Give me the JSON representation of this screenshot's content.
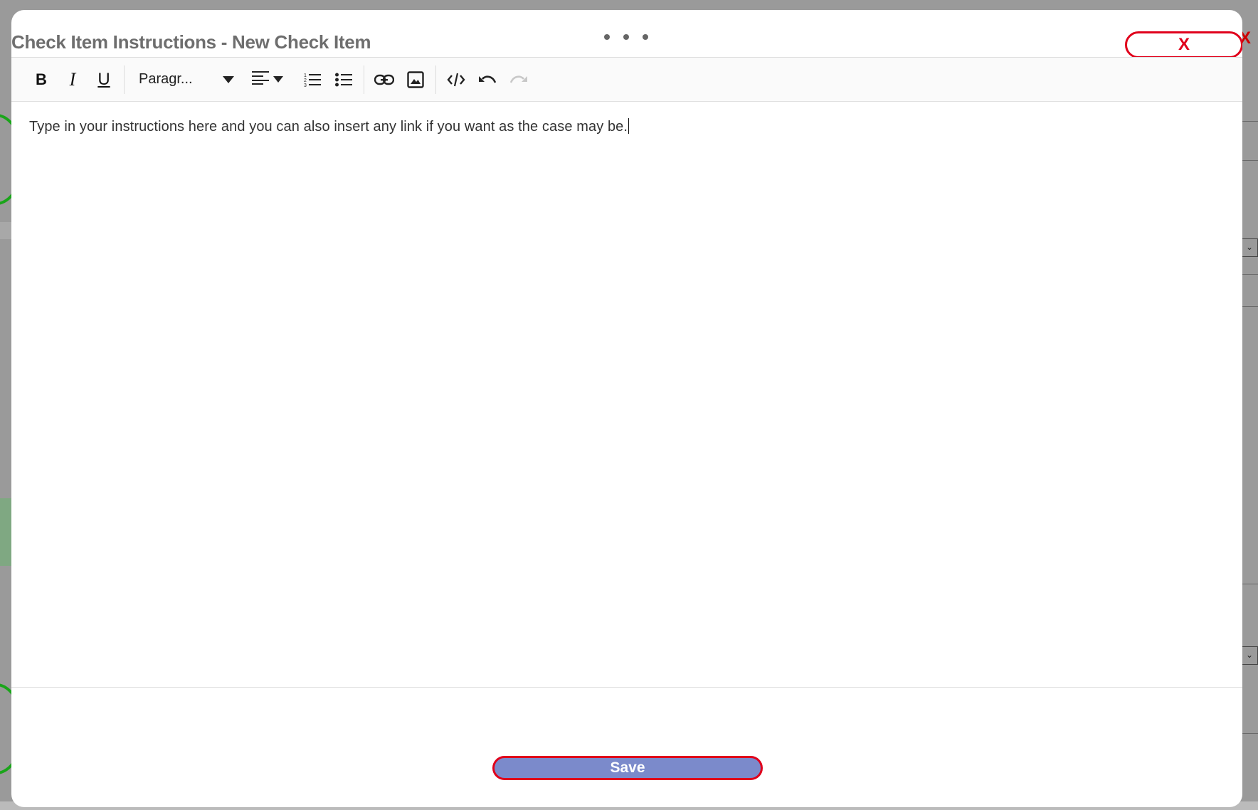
{
  "modal": {
    "title": "Check Item Instructions - New Check Item",
    "close_label": "X",
    "save_label": "Save"
  },
  "toolbar": {
    "bold": "B",
    "italic": "I",
    "underline": "U",
    "format_value": "Paragr...",
    "icons": [
      "bold-icon",
      "italic-icon",
      "underline-icon",
      "chevron-down-icon",
      "align-left-icon",
      "numbered-list-icon",
      "bulleted-list-icon",
      "link-icon",
      "image-icon",
      "code-view-icon",
      "undo-icon",
      "redo-icon"
    ]
  },
  "editor": {
    "content": "Type in your instructions here and you can also insert any link if you want as the case may be."
  },
  "background": {
    "close_label": "X",
    "select_chevron": "⌄"
  },
  "colors": {
    "accent_red": "#e0001b",
    "save_fill": "#7b8acb",
    "title_gray": "#6e6e6e"
  }
}
